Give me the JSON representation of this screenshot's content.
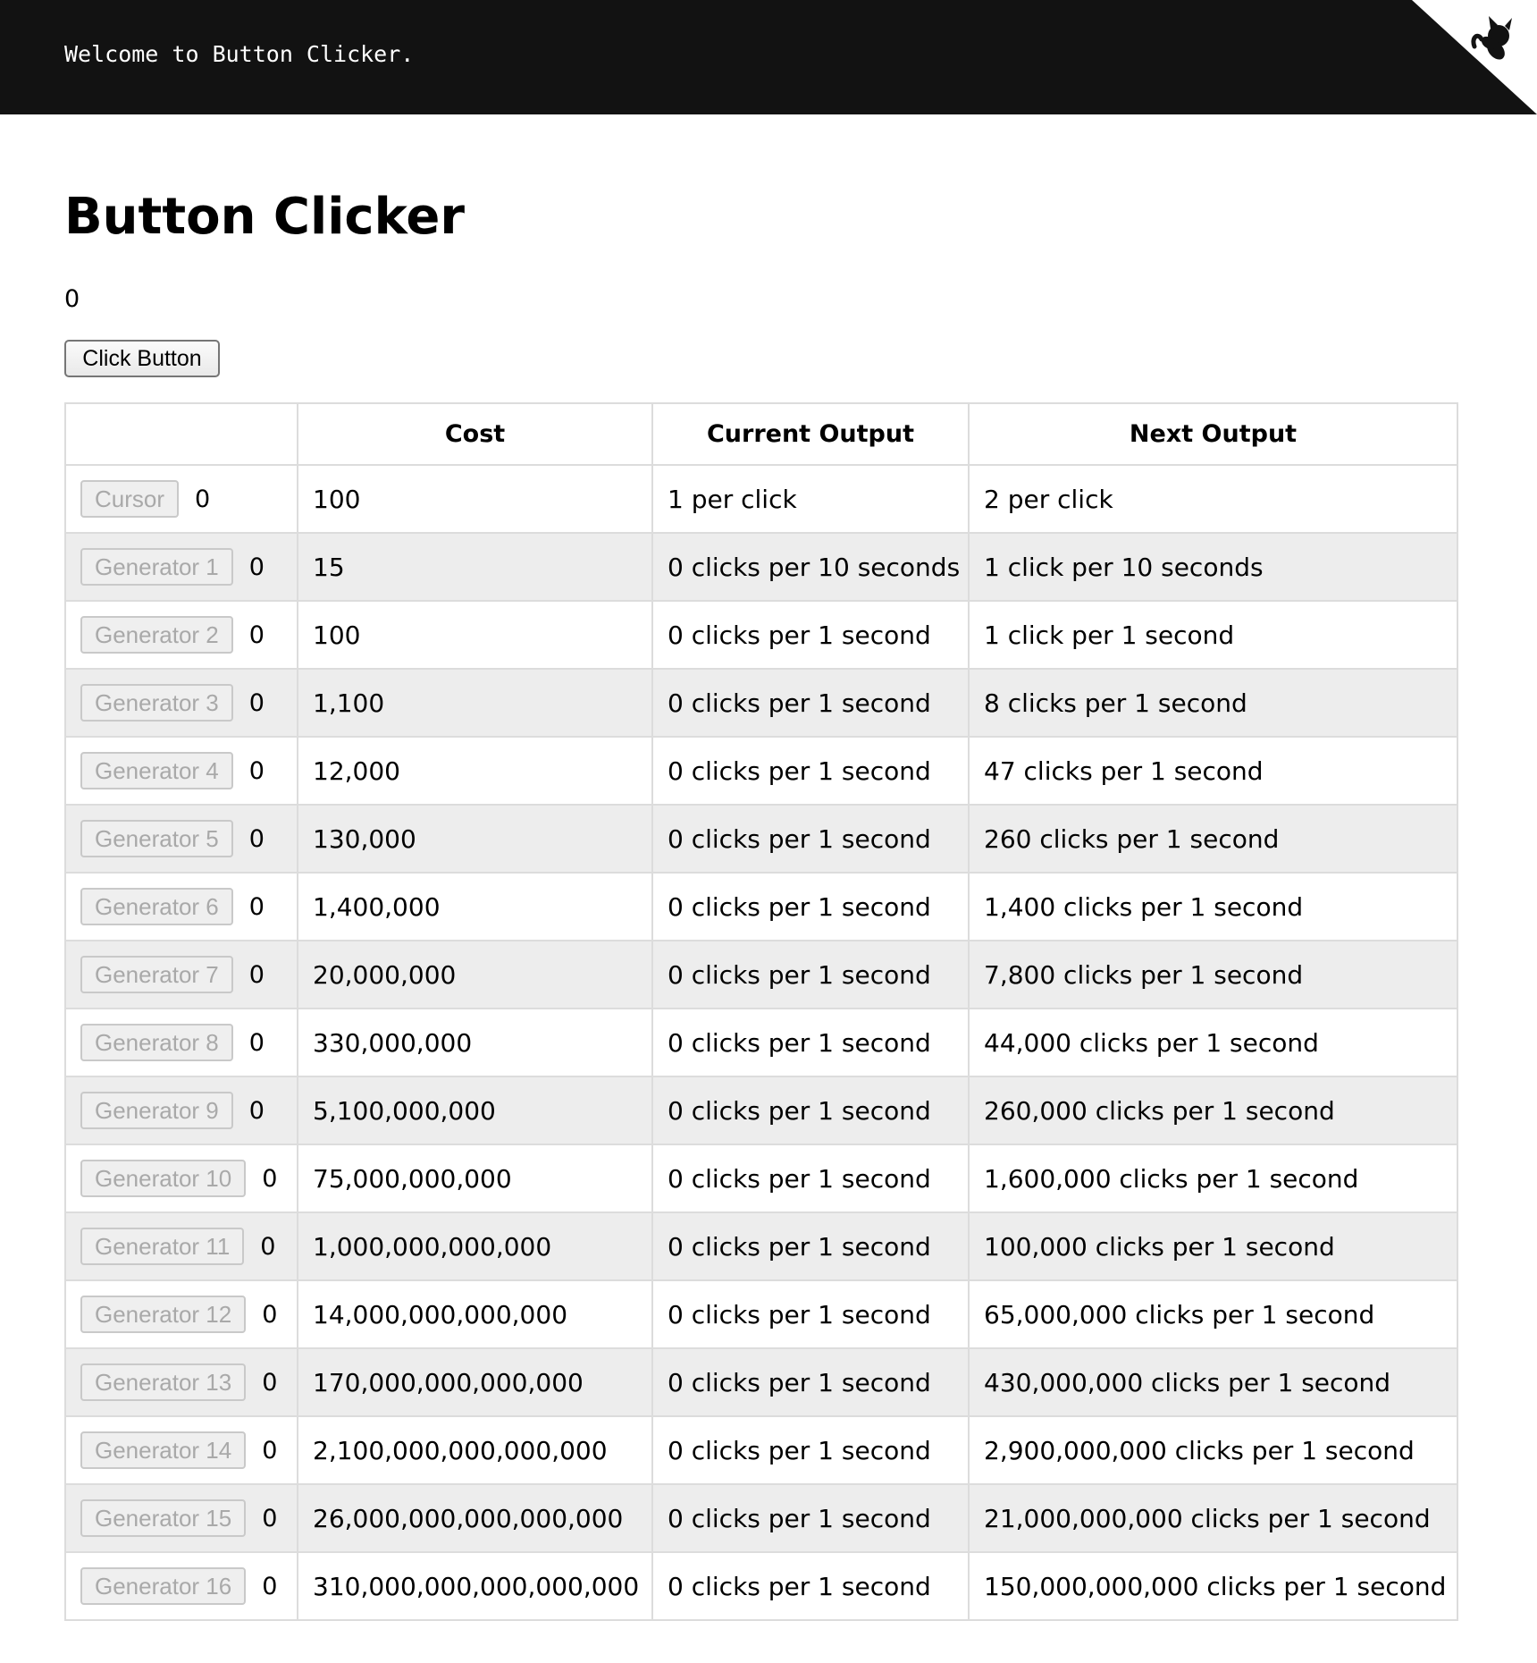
{
  "header": {
    "welcome_text": "Welcome to Button Clicker.",
    "corner_icon": "github-cat-icon"
  },
  "page": {
    "title": "Button Clicker",
    "clicks": "0",
    "click_button_label": "Click Button"
  },
  "table": {
    "headers": [
      "",
      "Cost",
      "Current Output",
      "Next Output"
    ],
    "rows": [
      {
        "name": "Cursor",
        "owned": "0",
        "cost": "100",
        "current": "1 per click",
        "next": "2 per click"
      },
      {
        "name": "Generator 1",
        "owned": "0",
        "cost": "15",
        "current": "0 clicks per 10 seconds",
        "next": "1 click per 10 seconds"
      },
      {
        "name": "Generator 2",
        "owned": "0",
        "cost": "100",
        "current": "0 clicks per 1 second",
        "next": "1 click per 1 second"
      },
      {
        "name": "Generator 3",
        "owned": "0",
        "cost": "1,100",
        "current": "0 clicks per 1 second",
        "next": "8 clicks per 1 second"
      },
      {
        "name": "Generator 4",
        "owned": "0",
        "cost": "12,000",
        "current": "0 clicks per 1 second",
        "next": "47 clicks per 1 second"
      },
      {
        "name": "Generator 5",
        "owned": "0",
        "cost": "130,000",
        "current": "0 clicks per 1 second",
        "next": "260 clicks per 1 second"
      },
      {
        "name": "Generator 6",
        "owned": "0",
        "cost": "1,400,000",
        "current": "0 clicks per 1 second",
        "next": "1,400 clicks per 1 second"
      },
      {
        "name": "Generator 7",
        "owned": "0",
        "cost": "20,000,000",
        "current": "0 clicks per 1 second",
        "next": "7,800 clicks per 1 second"
      },
      {
        "name": "Generator 8",
        "owned": "0",
        "cost": "330,000,000",
        "current": "0 clicks per 1 second",
        "next": "44,000 clicks per 1 second"
      },
      {
        "name": "Generator 9",
        "owned": "0",
        "cost": "5,100,000,000",
        "current": "0 clicks per 1 second",
        "next": "260,000 clicks per 1 second"
      },
      {
        "name": "Generator 10",
        "owned": "0",
        "cost": "75,000,000,000",
        "current": "0 clicks per 1 second",
        "next": "1,600,000 clicks per 1 second"
      },
      {
        "name": "Generator 11",
        "owned": "0",
        "cost": "1,000,000,000,000",
        "current": "0 clicks per 1 second",
        "next": "100,000 clicks per 1 second"
      },
      {
        "name": "Generator 12",
        "owned": "0",
        "cost": "14,000,000,000,000",
        "current": "0 clicks per 1 second",
        "next": "65,000,000 clicks per 1 second"
      },
      {
        "name": "Generator 13",
        "owned": "0",
        "cost": "170,000,000,000,000",
        "current": "0 clicks per 1 second",
        "next": "430,000,000 clicks per 1 second"
      },
      {
        "name": "Generator 14",
        "owned": "0",
        "cost": "2,100,000,000,000,000",
        "current": "0 clicks per 1 second",
        "next": "2,900,000,000 clicks per 1 second"
      },
      {
        "name": "Generator 15",
        "owned": "0",
        "cost": "26,000,000,000,000,000",
        "current": "0 clicks per 1 second",
        "next": "21,000,000,000 clicks per 1 second"
      },
      {
        "name": "Generator 16",
        "owned": "0",
        "cost": "310,000,000,000,000,000",
        "current": "0 clicks per 1 second",
        "next": "150,000,000,000 clicks per 1 second"
      }
    ]
  },
  "colors": {
    "topbar": "#121212",
    "stripe": "#ededed",
    "border": "#dcdcdc",
    "disabled_text": "#a9a9a9"
  }
}
